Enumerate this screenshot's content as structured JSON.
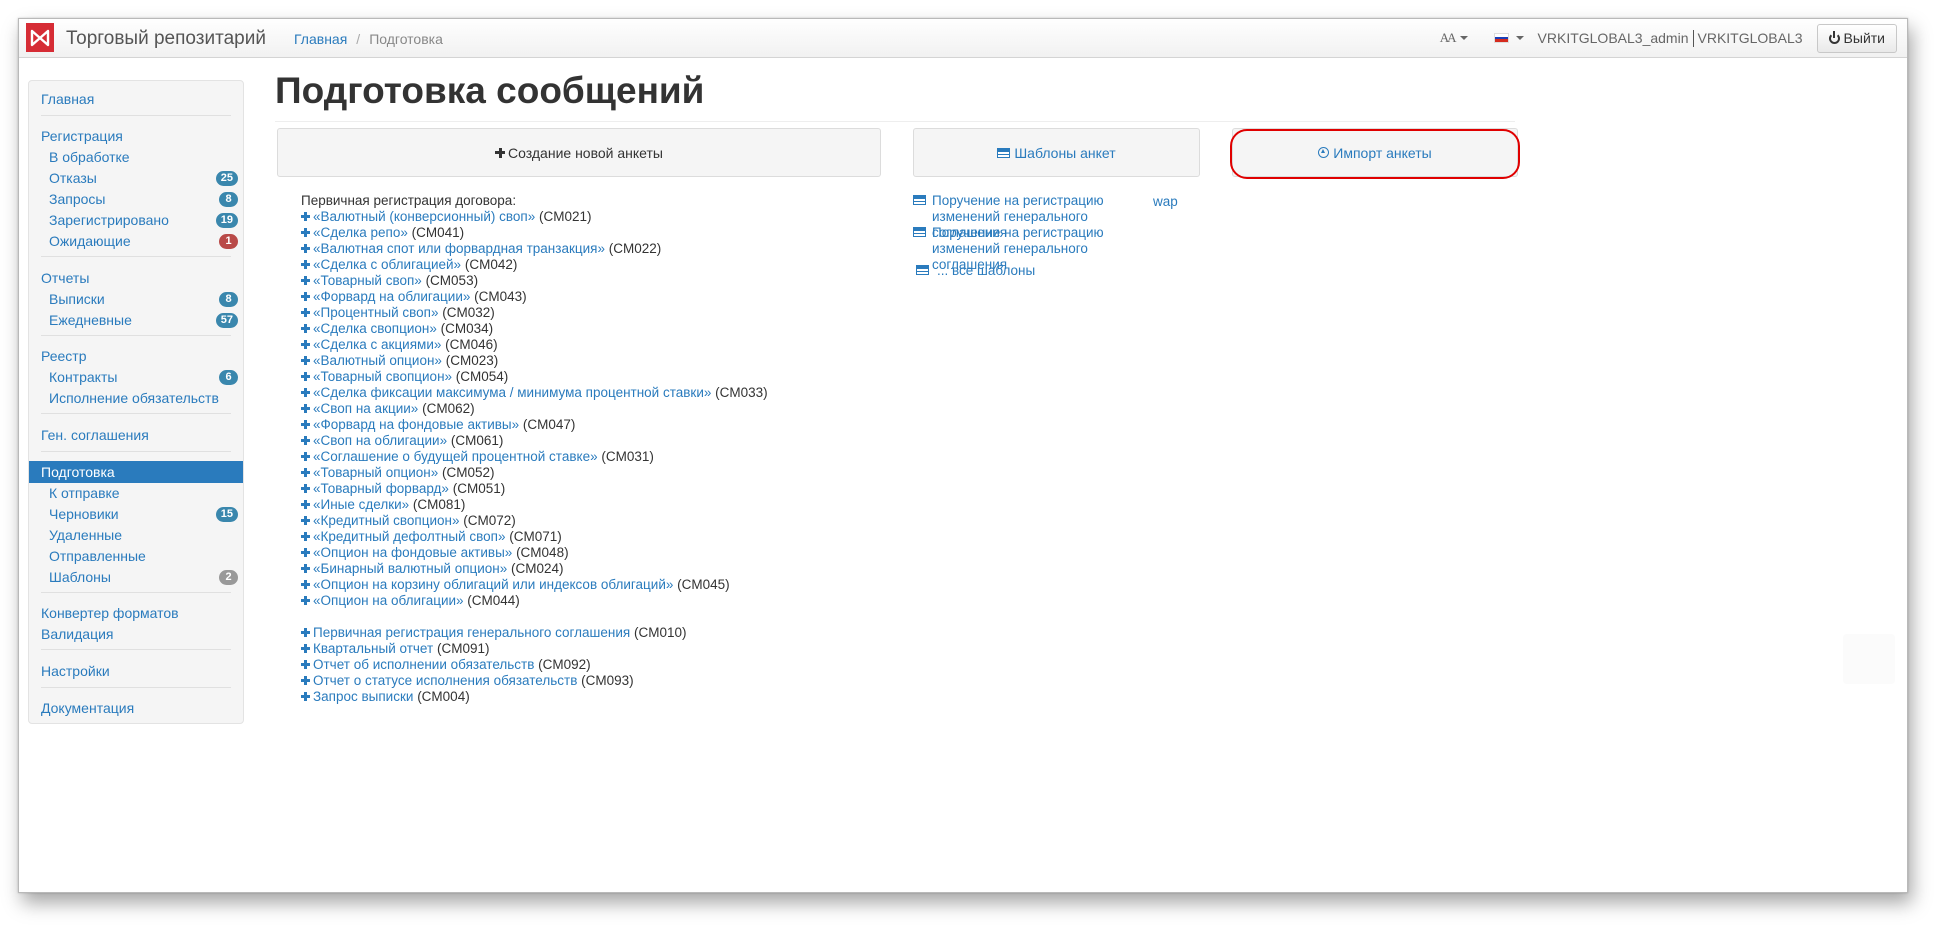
{
  "navbar": {
    "brand": "Торговый репозитарий",
    "breadcrumb": [
      "Главная",
      "Подготовка"
    ],
    "font_toggle": "AA",
    "user": "VRKITGLOBAL3_admin",
    "org": "VRKITGLOBAL3",
    "logout_label": "Выйти",
    "flag_colors": [
      "#ffffff",
      "#1c3fb7",
      "#d52b1e"
    ]
  },
  "sidebar": {
    "items": [
      {
        "label": "Главная",
        "level": "top",
        "badge": null
      },
      {
        "label": "Регистрация",
        "level": "top",
        "badge": null
      },
      {
        "label": "В обработке",
        "level": "sub",
        "badge": null
      },
      {
        "label": "Отказы",
        "level": "sub",
        "badge": "25",
        "badge_color": "#3a87ad"
      },
      {
        "label": "Запросы",
        "level": "sub",
        "badge": "8",
        "badge_color": "#3a87ad"
      },
      {
        "label": "Зарегистрировано",
        "level": "sub",
        "badge": "19",
        "badge_color": "#3a87ad"
      },
      {
        "label": "Ожидающие",
        "level": "sub",
        "badge": "1",
        "badge_color": "#b94a48"
      },
      {
        "label": "Отчеты",
        "level": "top",
        "badge": null
      },
      {
        "label": "Выписки",
        "level": "sub",
        "badge": "8",
        "badge_color": "#3a87ad"
      },
      {
        "label": "Ежедневные",
        "level": "sub",
        "badge": "57",
        "badge_color": "#3a87ad"
      },
      {
        "label": "Реестр",
        "level": "top",
        "badge": null
      },
      {
        "label": "Контракты",
        "level": "sub",
        "badge": "6",
        "badge_color": "#3a87ad"
      },
      {
        "label": "Исполнение обязательств",
        "level": "sub",
        "badge": null
      },
      {
        "label": "Ген. соглашения",
        "level": "top",
        "badge": null
      },
      {
        "label": "Подготовка",
        "level": "top",
        "badge": null,
        "active": true
      },
      {
        "label": "К отправке",
        "level": "sub",
        "badge": null
      },
      {
        "label": "Черновики",
        "level": "sub",
        "badge": "15",
        "badge_color": "#3a87ad"
      },
      {
        "label": "Удаленные",
        "level": "sub",
        "badge": null
      },
      {
        "label": "Отправленные",
        "level": "sub",
        "badge": null
      },
      {
        "label": "Шаблоны",
        "level": "sub",
        "badge": "2",
        "badge_color": "#999999"
      },
      {
        "label": "Конвертер форматов",
        "level": "top",
        "badge": null
      },
      {
        "label": "Валидация",
        "level": "top",
        "badge": null
      },
      {
        "label": "Настройки",
        "level": "top",
        "badge": null
      },
      {
        "label": "Документация",
        "level": "top",
        "badge": null
      }
    ]
  },
  "main": {
    "title": "Подготовка сообщений",
    "create_label": "Создание новой анкеты",
    "templates_label": "Шаблоны анкет",
    "import_label": "Импорт анкеты",
    "list_heading": "Первичная регистрация договора:",
    "contracts": [
      {
        "name": "«Валютный (конверсионный) своп»",
        "code": "(CM021)"
      },
      {
        "name": "«Сделка репо»",
        "code": "(CM041)"
      },
      {
        "name": "«Валютная спот или форвардная транзакция»",
        "code": "(CM022)"
      },
      {
        "name": "«Сделка с облигацией»",
        "code": "(CM042)"
      },
      {
        "name": "«Товарный своп»",
        "code": "(CM053)"
      },
      {
        "name": "«Форвард на облигации»",
        "code": "(CM043)"
      },
      {
        "name": "«Процентный своп»",
        "code": "(CM032)"
      },
      {
        "name": "«Сделка свопцион»",
        "code": "(CM034)"
      },
      {
        "name": "«Сделка с акциями»",
        "code": "(CM046)"
      },
      {
        "name": "«Валютный опцион»",
        "code": "(CM023)"
      },
      {
        "name": "«Товарный свопцион»",
        "code": "(CM054)"
      },
      {
        "name": "«Сделка фиксации максимума / минимума процентной ставки»",
        "code": "(CM033)"
      },
      {
        "name": "«Своп на акции»",
        "code": "(CM062)"
      },
      {
        "name": "«Форвард на фондовые активы»",
        "code": "(CM047)"
      },
      {
        "name": "«Своп на облигации»",
        "code": "(CM061)"
      },
      {
        "name": "«Соглашение о будущей процентной ставке»",
        "code": "(CM031)"
      },
      {
        "name": "«Товарный опцион»",
        "code": "(CM052)"
      },
      {
        "name": "«Товарный форвард»",
        "code": "(CM051)"
      },
      {
        "name": "«Иные сделки»",
        "code": "(CM081)"
      },
      {
        "name": "«Кредитный свопцион»",
        "code": "(CM072)"
      },
      {
        "name": "«Кредитный дефолтный своп»",
        "code": "(CM071)"
      },
      {
        "name": "«Опцион на фондовые активы»",
        "code": "(CM048)"
      },
      {
        "name": "«Бинарный валютный опцион»",
        "code": "(CM024)"
      },
      {
        "name": "«Опцион на корзину облигаций или индексов облигаций»",
        "code": "(CM045)"
      },
      {
        "name": "«Опцион на облигации»",
        "code": "(CM044)"
      }
    ],
    "other_forms": [
      {
        "name": "Первичная регистрация генерального соглашения",
        "code": "(CM010)"
      },
      {
        "name": "Квартальный отчет",
        "code": "(CM091)"
      },
      {
        "name": "Отчет об исполнении обязательств",
        "code": "(CM092)"
      },
      {
        "name": "Отчет о статусе исполнения обязательств",
        "code": "(CM093)"
      },
      {
        "name": "Запрос выписки",
        "code": "(CM004)"
      }
    ],
    "templates": [
      "Поручение на регистрацию изменений генерального соглашения",
      "Поручение на регистрацию изменений генерального соглашения",
      "... все шаблоны"
    ],
    "wap_label": "wap"
  }
}
